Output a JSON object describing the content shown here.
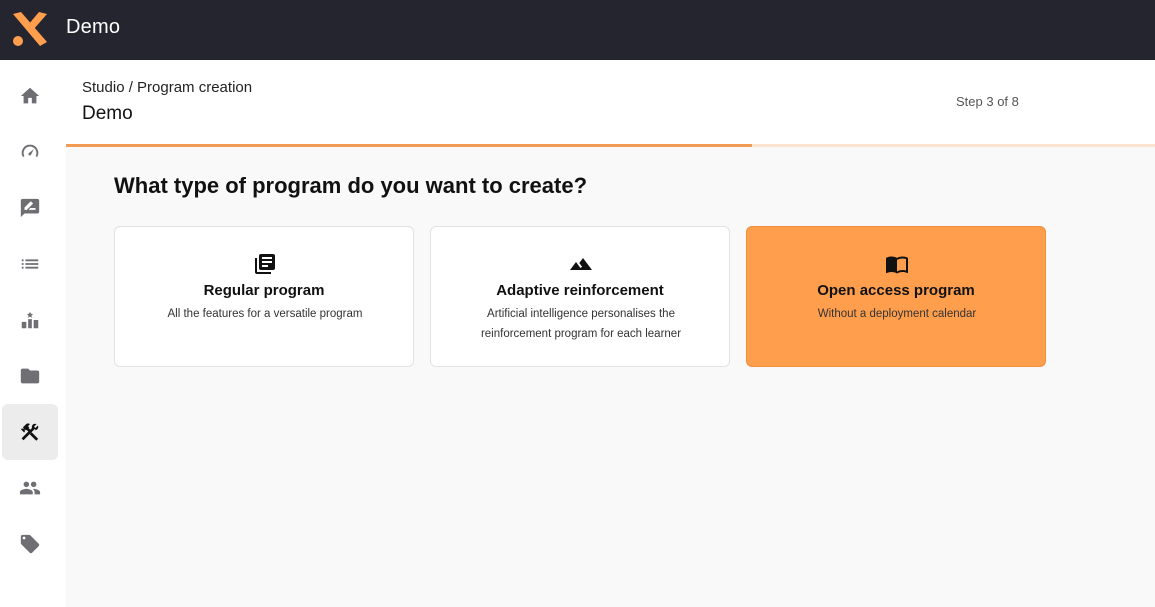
{
  "app": {
    "title": "Demo",
    "brand_color": "#ff9f4e",
    "topbar_color": "#25252f"
  },
  "sidebar": {
    "items": [
      {
        "icon": "home-icon"
      },
      {
        "icon": "dashboard-icon"
      },
      {
        "icon": "edit-message-icon"
      },
      {
        "icon": "list-icon"
      },
      {
        "icon": "leaderboard-icon"
      },
      {
        "icon": "folder-icon"
      },
      {
        "icon": "tools-icon",
        "active": true
      },
      {
        "icon": "people-icon"
      },
      {
        "icon": "tag-icon"
      }
    ]
  },
  "header": {
    "breadcrumb": "Studio / Program creation",
    "title": "Demo",
    "step_text": "Step 3 of 8",
    "progress": 0.63
  },
  "main": {
    "question": "What type of program do you want to create?",
    "cards": [
      {
        "icon": "library-books-icon",
        "title": "Regular program",
        "description": "All the features for a versatile program",
        "selected": false
      },
      {
        "icon": "landscape-icon",
        "title": "Adaptive reinforcement",
        "description": "Artificial intelligence personalises the reinforcement program for each learner",
        "selected": false
      },
      {
        "icon": "open-book-icon",
        "title": "Open access program",
        "description": "Without a deployment calendar",
        "selected": true
      }
    ]
  }
}
